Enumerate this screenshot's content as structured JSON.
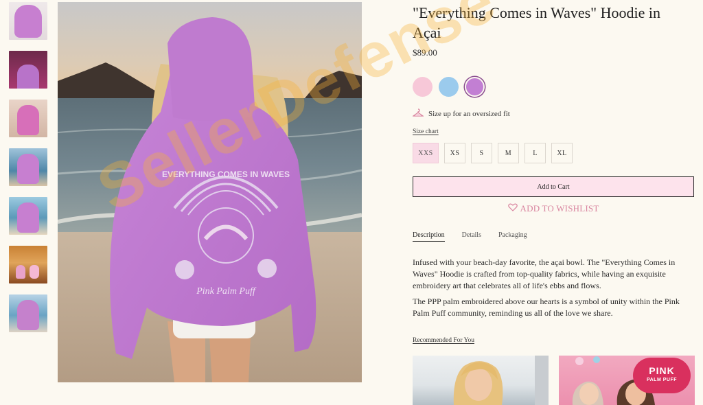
{
  "product": {
    "title": "\"Everything Comes in Waves\" Hoodie in Açai",
    "price": "$89.00"
  },
  "swatches": [
    {
      "name": "pink",
      "color": "#f7c8d8"
    },
    {
      "name": "blue",
      "color": "#9bcbed"
    },
    {
      "name": "acai",
      "color": "#c27fd3",
      "selected": true
    }
  ],
  "fit_note": "Size up for an oversized fit",
  "size_chart_label": "Size chart",
  "sizes": [
    "XXS",
    "XS",
    "S",
    "M",
    "L",
    "XL"
  ],
  "selected_size": "XXS",
  "add_to_cart_label": "Add to Cart",
  "wishlist_label": "ADD TO WISHLIST",
  "tabs": [
    "Description",
    "Details",
    "Packaging"
  ],
  "active_tab": "Description",
  "description": [
    "Infused with your beach-day favorite, the açai bowl. The \"Everything Comes in Waves\" Hoodie is crafted from top-quality fabrics, while having an exquisite embroidery art that celebrates all of life's ebbs and flows.",
    "The PPP palm embroidered above our hearts is a symbol of unity within the Pink Palm Puff community, reminding us all of the love we share."
  ],
  "recommended_title": "Recommended For You",
  "rec_logo": {
    "line1": "PINK",
    "line2": "PALM PUFF"
  },
  "hoodie_print": {
    "line1": "EVERYTHING COMES IN WAVES",
    "line2": "Pink Palm Puff"
  },
  "watermark": "SellerDefense",
  "colors": {
    "accent_pink": "#fde3ec",
    "wishlist": "#d9849f",
    "background": "#fcf9f1"
  }
}
